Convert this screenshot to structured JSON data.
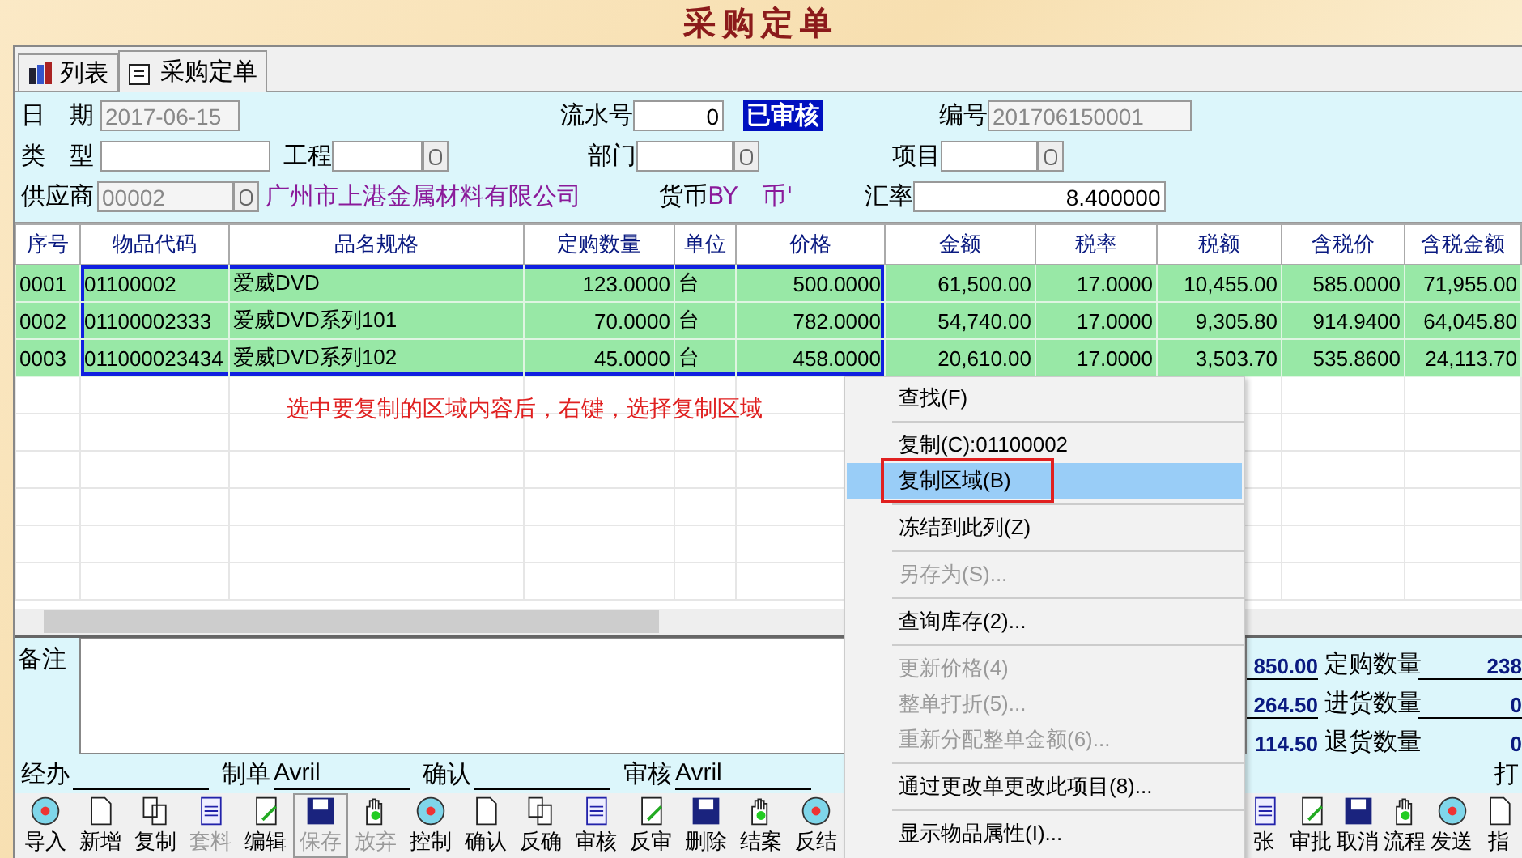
{
  "title": "采购定单",
  "tabs": [
    {
      "label": "列表",
      "selected": false
    },
    {
      "label": "采购定单",
      "selected": true
    }
  ],
  "form": {
    "date_label": "日　期",
    "date": "2017-06-15",
    "serial_label": "流水号",
    "serial": "0",
    "status": "已审核",
    "number_label": "编号",
    "number": "201706150001",
    "type_label": "类　型",
    "project_label": "工程",
    "dept_label": "部门",
    "item_label": "项目",
    "supplier_label": "供应商",
    "supplier_code": "00002",
    "supplier_name": "广州市上港金属材料有限公司",
    "currency_label": "货币",
    "currency": "BY　币'",
    "rate_label": "汇率",
    "rate": "8.400000"
  },
  "table": {
    "columns": [
      {
        "label": "序号",
        "selected": false,
        "kind": "text"
      },
      {
        "label": "物品代码",
        "selected": true,
        "kind": "text"
      },
      {
        "label": "品名规格",
        "selected": true,
        "kind": "text"
      },
      {
        "label": "定购数量",
        "selected": true,
        "kind": "number"
      },
      {
        "label": "单位",
        "selected": true,
        "kind": "text"
      },
      {
        "label": "价格",
        "selected": true,
        "kind": "number"
      },
      {
        "label": "金额",
        "selected": false,
        "kind": "number"
      },
      {
        "label": "税率",
        "selected": false,
        "kind": "number"
      },
      {
        "label": "税额",
        "selected": false,
        "kind": "number"
      },
      {
        "label": "含税价",
        "selected": false,
        "kind": "number"
      },
      {
        "label": "含税金额",
        "selected": false,
        "kind": "number"
      }
    ],
    "rows": [
      {
        "selected": true,
        "cells": [
          "0001",
          "01100002",
          "爱威DVD",
          "123.0000",
          "台",
          "500.0000",
          "61,500.00",
          "17.0000",
          "10,455.00",
          "585.0000",
          "71,955.00"
        ]
      },
      {
        "selected": true,
        "cells": [
          "0002",
          "01100002333",
          "爱威DVD系列101",
          "70.0000",
          "台",
          "782.0000",
          "54,740.00",
          "17.0000",
          "9,305.80",
          "914.9400",
          "64,045.80"
        ]
      },
      {
        "selected": true,
        "cells": [
          "0003",
          "011000023434",
          "爱威DVD系列102",
          "45.0000",
          "台",
          "458.0000",
          "20,610.00",
          "17.0000",
          "3,503.70",
          "535.8600",
          "24,113.70"
        ]
      }
    ],
    "note": "选中要复制的区域内容后，右键，选择复制区域"
  },
  "remark_label": "备注",
  "totals": [
    {
      "amount": "850.00",
      "label": "定购数量",
      "value": "238"
    },
    {
      "amount": "264.50",
      "label": "进货数量",
      "value": "0"
    },
    {
      "amount": "114.50",
      "label": "退货数量",
      "value": "0"
    }
  ],
  "signatures": [
    {
      "label": "经办"
    },
    {
      "label": "制单",
      "value": "Avril"
    },
    {
      "label": "确认"
    },
    {
      "label": "审核",
      "value": "Avril"
    }
  ],
  "print_label": "打",
  "toolbar_left": [
    {
      "label": "导入",
      "disabled": false,
      "pressed": false
    },
    {
      "label": "新增",
      "disabled": false,
      "pressed": false
    },
    {
      "label": "复制",
      "disabled": false,
      "pressed": false
    },
    {
      "label": "套料",
      "disabled": true,
      "pressed": false
    },
    {
      "label": "编辑",
      "disabled": false,
      "pressed": false
    },
    {
      "label": "保存",
      "disabled": true,
      "pressed": true
    },
    {
      "label": "放弃",
      "disabled": true,
      "pressed": false
    },
    {
      "label": "控制",
      "disabled": false,
      "pressed": false
    },
    {
      "label": "确认",
      "disabled": false,
      "pressed": false
    },
    {
      "label": "反确",
      "disabled": false,
      "pressed": false
    },
    {
      "label": "审核",
      "disabled": false,
      "pressed": false
    },
    {
      "label": "反审",
      "disabled": false,
      "pressed": false
    },
    {
      "label": "删除",
      "disabled": false,
      "pressed": false
    },
    {
      "label": "结案",
      "disabled": false,
      "pressed": false
    },
    {
      "label": "反结",
      "disabled": false,
      "pressed": false
    }
  ],
  "toolbar_right": [
    {
      "label": "张",
      "disabled": false,
      "pressed": false
    },
    {
      "label": "审批",
      "disabled": false,
      "pressed": false
    },
    {
      "label": "取消",
      "disabled": false,
      "pressed": false
    },
    {
      "label": "流程",
      "disabled": false,
      "pressed": false
    },
    {
      "label": "发送",
      "disabled": false,
      "pressed": false
    },
    {
      "label": "指",
      "disabled": false,
      "pressed": false
    }
  ],
  "context_menu": {
    "groups": [
      {
        "items": [
          {
            "label": "查找(F)",
            "disabled": false,
            "selected": false,
            "annotated": false
          }
        ]
      },
      {
        "items": [
          {
            "label": "复制(C):01100002",
            "disabled": false,
            "selected": false,
            "annotated": false
          },
          {
            "label": "复制区域(B)",
            "disabled": false,
            "selected": true,
            "annotated": true
          }
        ]
      },
      {
        "items": [
          {
            "label": "冻结到此列(Z)",
            "disabled": false,
            "selected": false,
            "annotated": false
          }
        ]
      },
      {
        "items": [
          {
            "label": "另存为(S)...",
            "disabled": true,
            "selected": false,
            "annotated": false
          }
        ]
      },
      {
        "items": [
          {
            "label": "查询库存(2)...",
            "disabled": false,
            "selected": false,
            "annotated": false
          }
        ]
      },
      {
        "items": [
          {
            "label": "更新价格(4)",
            "disabled": true,
            "selected": false,
            "annotated": false
          },
          {
            "label": "整单打折(5)...",
            "disabled": true,
            "selected": false,
            "annotated": false
          },
          {
            "label": "重新分配整单金额(6)...",
            "disabled": true,
            "selected": false,
            "annotated": false
          }
        ]
      },
      {
        "items": [
          {
            "label": "通过更改单更改此项目(8)...",
            "disabled": false,
            "selected": false,
            "annotated": false
          }
        ]
      },
      {
        "items": [
          {
            "label": "显示物品属性(I)...",
            "disabled": false,
            "selected": false,
            "annotated": false
          }
        ]
      }
    ]
  }
}
